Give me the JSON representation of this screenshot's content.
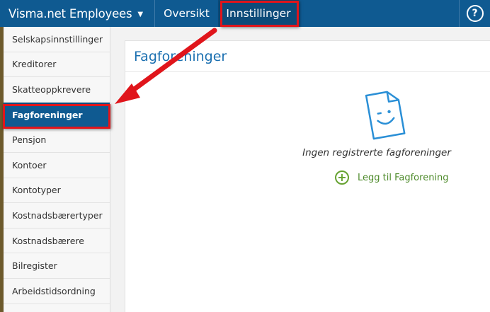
{
  "header": {
    "brand": "Visma.net Employees",
    "brand_chevron": "⌄",
    "nav": [
      "Oversikt",
      "Innstillinger"
    ],
    "help_label": "?"
  },
  "sidebar": {
    "items": [
      {
        "label": "Selskapsinnstillinger"
      },
      {
        "label": "Kreditorer"
      },
      {
        "label": "Skatteoppkrevere"
      },
      {
        "label": "Fagforeninger",
        "active": true
      },
      {
        "label": "Pensjon"
      },
      {
        "label": "Kontoer"
      },
      {
        "label": "Kontotyper"
      },
      {
        "label": "Kostnadsbærertyper"
      },
      {
        "label": "Kostnadsbærere"
      },
      {
        "label": "Bilregister"
      },
      {
        "label": "Arbeidstidsordning"
      }
    ]
  },
  "main": {
    "title": "Fagforeninger",
    "empty_icon": "smiling-document-icon",
    "empty_text": "Ingen registrerte fagforeninger",
    "add_label": "Legg til Fagforening",
    "add_icon": "plus-circle-icon"
  },
  "colors": {
    "topbar": "#0f5a91",
    "active_nav": "#0d4b79",
    "highlight": "#e0151b",
    "title": "#1a6fb0",
    "add": "#66a231"
  }
}
